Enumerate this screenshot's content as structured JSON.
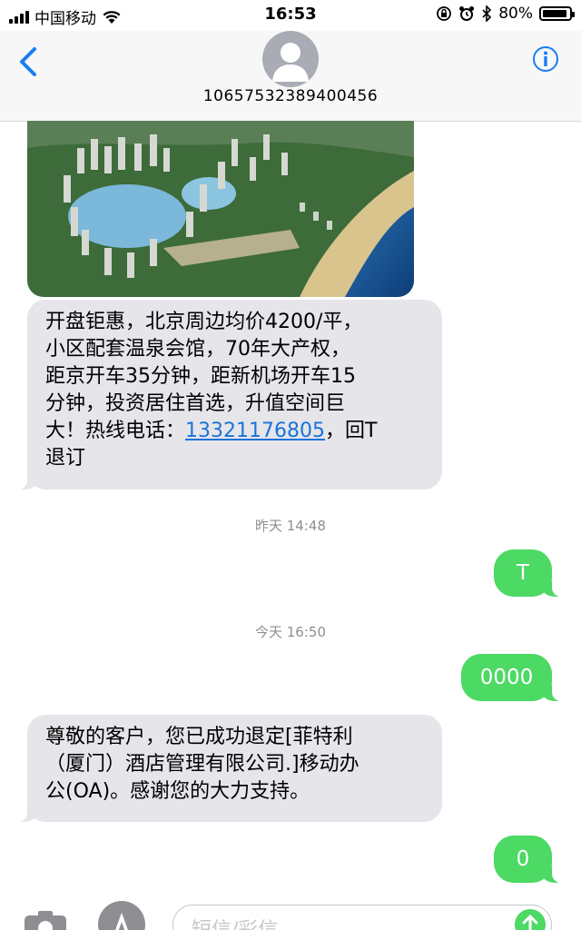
{
  "status_bar": {
    "carrier": "中国移动",
    "time": "16:53",
    "battery": "80%",
    "battery_level": 0.8
  },
  "header": {
    "contact": "1065753238940045​6",
    "back_icon": "chevron-left-icon",
    "info_icon": "info-icon"
  },
  "messages": [
    {
      "side": "in",
      "parts": [
        "开盘钜惠，北京周边均价4200/平，",
        "小区配套温泉会馆，70年大产权，",
        "距京开车35分钟，距新机场开车15",
        "分钟，投资居住首选，升值空间巨",
        "大！热线电话：",
        "13321176805",
        "，回T",
        "退订"
      ]
    },
    {
      "side": "timestamp",
      "text": "昨天 14:48"
    },
    {
      "side": "out",
      "text": "T"
    },
    {
      "side": "timestamp",
      "text": "今天 16:50"
    },
    {
      "side": "out",
      "text": "0000"
    },
    {
      "side": "in",
      "lines": [
        "尊敬的客户，您已成功退定[菲特利",
        "（厦门）酒店管理有限公司.]移动办",
        "公(OA)。感谢您的大力支持。"
      ]
    },
    {
      "side": "out",
      "text": "0"
    }
  ],
  "input_bar": {
    "placeholder": "短信/彩信"
  },
  "colors": {
    "incoming_bubble": "#e5e5ea",
    "outgoing_bubble": "#4cd964",
    "accent": "#1a73d9"
  }
}
